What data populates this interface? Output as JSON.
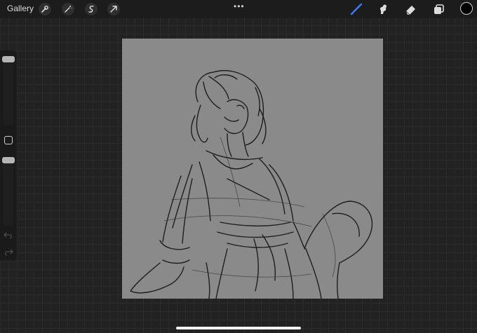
{
  "topbar": {
    "gallery_label": "Gallery",
    "left_tools": [
      {
        "name": "wrench-icon"
      },
      {
        "name": "magic-wand-icon"
      },
      {
        "name": "selection-icon"
      },
      {
        "name": "transform-arrow-icon"
      }
    ],
    "more_dots": "•••",
    "right_tools": [
      {
        "name": "brush-icon",
        "active": true
      },
      {
        "name": "smudge-icon",
        "active": false
      },
      {
        "name": "eraser-icon",
        "active": false
      },
      {
        "name": "layers-icon",
        "active": false
      }
    ],
    "current_color": "#000000"
  },
  "colors": {
    "accent": "#3b7cf5",
    "canvas_bg": "#8a8a8a",
    "workspace_bg": "#222222"
  },
  "sidebar": {
    "brush_size_level": 1.0,
    "opacity_level": 1.0
  }
}
